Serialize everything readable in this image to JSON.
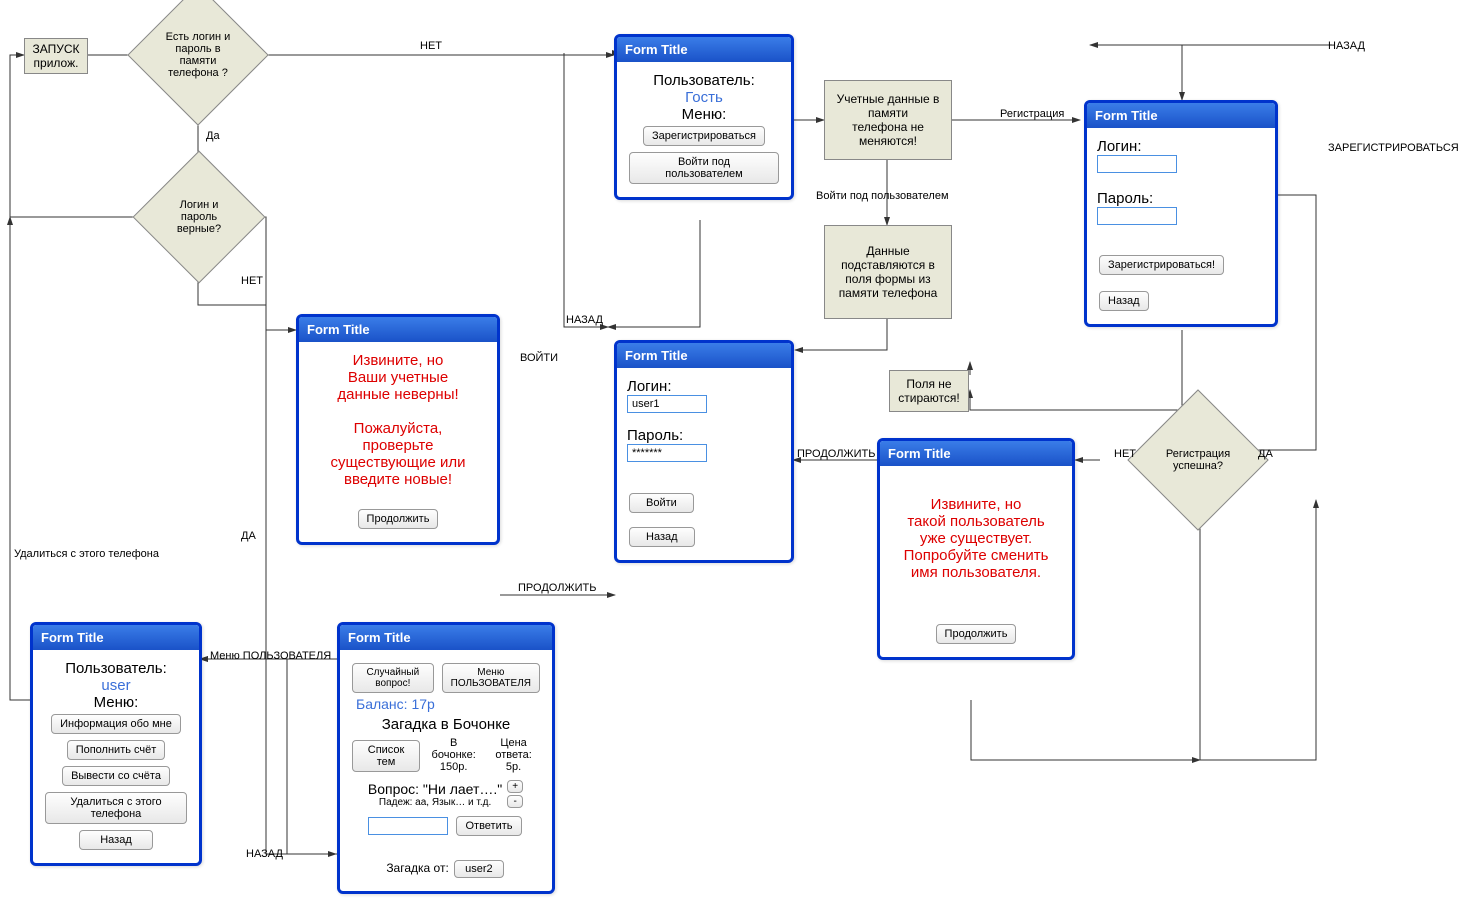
{
  "boxes": {
    "start": "ЗАПУСК\nприлож.",
    "memNote": "Учетные данные в памяти\nтелефона не меняются!",
    "fillNote": "Данные\nподставляются в\nполя формы из\nпамяти телефона",
    "noClear": "Поля не\nстираются!"
  },
  "diamonds": {
    "d1": "Есть логин и\nпароль в\nпамяти\nтелефона ?",
    "d2": "Логин и\nпароль\nверные?",
    "d3": "Регистрация\nуспешна?"
  },
  "forms": {
    "guest": {
      "title": "Form Title",
      "userLabel": "Пользователь:",
      "userName": "Гость",
      "menuLabel": "Меню:",
      "b1": "Зарегистрироваться",
      "b2": "Войти под пользователем"
    },
    "register": {
      "title": "Form Title",
      "loginLabel": "Логин:",
      "passLabel": "Пароль:",
      "b1": "Зарегистрироваться!",
      "b2": "Назад"
    },
    "error": {
      "title": "Form Title",
      "l1": "Извините, но",
      "l2": "Ваши учетные",
      "l3": "данные неверны!",
      "l4": "Пожалуйста,",
      "l5": "проверьте",
      "l6": "существующие или",
      "l7": "введите новые!",
      "b1": "Продолжить"
    },
    "login": {
      "title": "Form Title",
      "loginLabel": "Логин:",
      "loginVal": "user1",
      "passLabel": "Пароль:",
      "passVal": "*******",
      "b1": "Войти",
      "b2": "Назад"
    },
    "exists": {
      "title": "Form Title",
      "l1": "Извините, но",
      "l2": "такой пользователь",
      "l3": "уже существует.",
      "l4": "Попробуйте сменить",
      "l5": "имя пользователя.",
      "b1": "Продолжить"
    },
    "userMenu": {
      "title": "Form Title",
      "userLabel": "Пользователь:",
      "userName": "user",
      "menuLabel": "Меню:",
      "b1": "Информация обо мне",
      "b2": "Пополнить счёт",
      "b3": "Вывести со счёта",
      "b4": "Удалиться с этого телефона",
      "b5": "Назад"
    },
    "game": {
      "title": "Form Title",
      "b1": "Случайный вопрос!",
      "b2": "Меню\nПОЛЬЗОВАТЕЛЯ",
      "balance": "Баланс: 17р",
      "riddle": "Загадка в Бочонке",
      "b3": "Список тем",
      "potLabel": "В бочонке:",
      "potVal": "150р.",
      "priceLabel": "Цена ответа:",
      "priceVal": "5р.",
      "q": "Вопрос: \"Ни лает….\"",
      "hint": "Падеж: аа, Язык… и т.д.",
      "b4": "Ответить",
      "plus": "+",
      "minus": "-",
      "from": "Загадка от:",
      "author": "user2"
    }
  },
  "edges": {
    "no1": "НЕТ",
    "yes1": "Да",
    "no2": "НЕТ",
    "yes2": "ДА",
    "back1": "НАЗАД",
    "reg": "Регистрация",
    "signup": "ЗАРЕГИСТРИРОВАТЬСЯ",
    "loginAs": "Войти под пользователем",
    "back2": "НАЗАД",
    "enter": "ВОЙТИ",
    "cont": "ПРОДОЛЖИТЬ",
    "no3": "НЕТ",
    "yes3": "ДА",
    "cont2": "ПРОДОЛЖИТЬ",
    "delete": "Удалиться с этого телефона",
    "menuUser": "Меню ПОЛЬЗОВАТЕЛЯ",
    "back3": "НАЗАД"
  }
}
